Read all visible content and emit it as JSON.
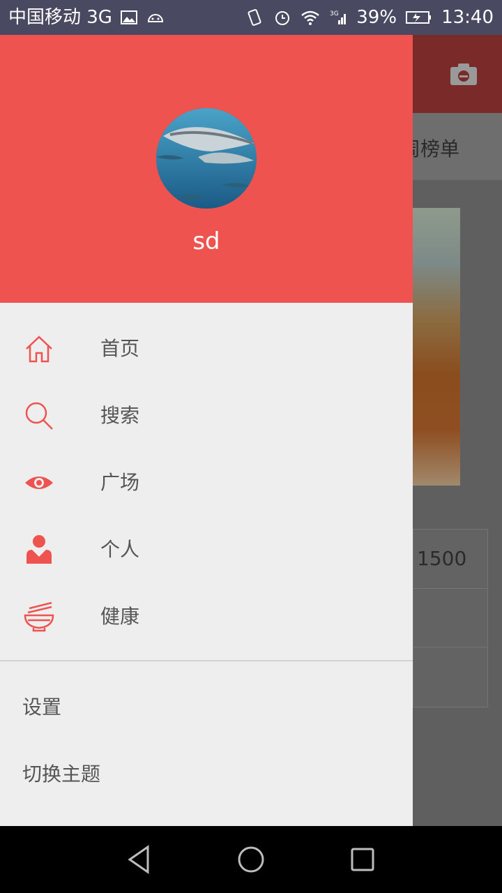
{
  "status_bar": {
    "carrier": "中国移动 3G",
    "battery": "39%",
    "time": "13:40",
    "icons": [
      "image-icon",
      "android-icon",
      "vibrate-icon",
      "alarm-icon",
      "wifi-icon",
      "signal-icon",
      "battery-charging-icon"
    ]
  },
  "background": {
    "tab_text": "周榜单",
    "card_text": "1500",
    "colors": {
      "toolbar": "#7a2a28"
    }
  },
  "drawer": {
    "header_color": "#ef5350",
    "username": "sd",
    "menu": [
      {
        "label": "首页",
        "icon": "home-icon"
      },
      {
        "label": "搜索",
        "icon": "search-icon"
      },
      {
        "label": "广场",
        "icon": "eye-icon"
      },
      {
        "label": "个人",
        "icon": "person-icon"
      },
      {
        "label": "健康",
        "icon": "bowl-icon"
      }
    ],
    "sub_menu": [
      {
        "label": "设置"
      },
      {
        "label": "切换主题"
      }
    ],
    "accent": "#ef5350"
  },
  "nav_bar": {
    "buttons": [
      "back-icon",
      "home-circle-icon",
      "recents-icon"
    ]
  }
}
